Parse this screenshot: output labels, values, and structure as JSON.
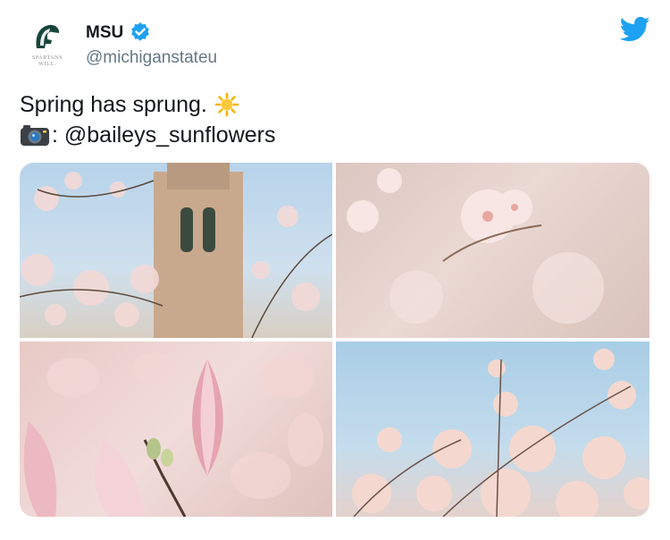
{
  "account": {
    "name": "MSU",
    "handle": "@michiganstateu",
    "avatar_line1": "SPARTANS",
    "avatar_line2": "WILL.",
    "verified": true
  },
  "tweet": {
    "line1": "Spring has sprung.",
    "line2": ": @baileys_sunflowers"
  },
  "icons": {
    "verified": "verified-badge-icon",
    "brand": "twitter-bird-icon",
    "sun": "sun-emoji-icon",
    "camera": "camera-emoji-icon",
    "avatar": "spartan-helmet-icon"
  },
  "colors": {
    "twitter_blue": "#1da1f2",
    "spartan_green": "#18453b",
    "handle_gray": "#657786"
  }
}
